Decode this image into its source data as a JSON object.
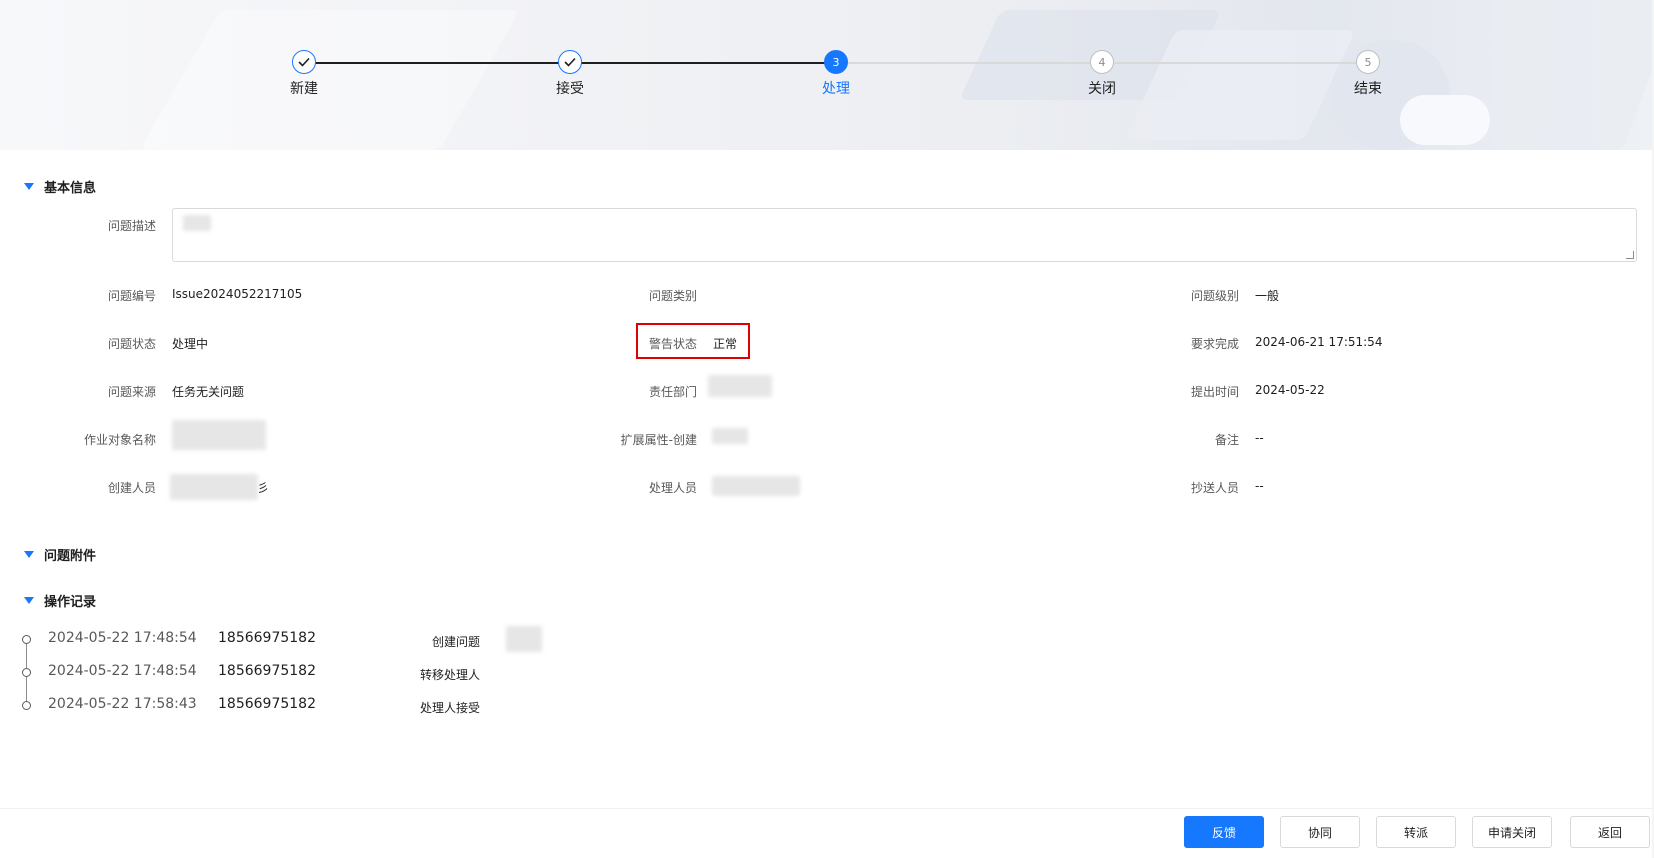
{
  "steps": [
    {
      "label": "新建",
      "status": "finished",
      "icon": "check-icon"
    },
    {
      "label": "接受",
      "status": "finished",
      "icon": "check-icon"
    },
    {
      "label": "处理",
      "status": "active",
      "number": "3"
    },
    {
      "label": "关闭",
      "status": "wait",
      "number": "4"
    },
    {
      "label": "结束",
      "status": "wait",
      "number": "5"
    }
  ],
  "basic_info": {
    "title": "基本信息",
    "description_label": "问题描述",
    "fields": {
      "issue_no_label": "问题编号",
      "issue_no": "Issue2024052217105",
      "category_label": "问题类别",
      "category": "",
      "level_label": "问题级别",
      "level": "一般",
      "status_label": "问题状态",
      "status": "处理中",
      "alert_label": "警告状态",
      "alert": "正常",
      "due_label": "要求完成",
      "due": "2024-06-21 17:51:54",
      "source_label": "问题来源",
      "source": "任务无关问题",
      "dept_label": "责任部门",
      "submit_label": "提出时间",
      "submit": "2024-05-22",
      "object_label": "作业对象名称",
      "ext_label": "扩展属性-创建",
      "remark_label": "备注",
      "remark": "--",
      "creator_label": "创建人员",
      "creator_suffix": "彡",
      "handler_label": "处理人员",
      "cc_label": "抄送人员",
      "cc": "--"
    }
  },
  "attachments": {
    "title": "问题附件"
  },
  "records": {
    "title": "操作记录",
    "items": [
      {
        "time": "2024-05-22 17:48:54",
        "user": "18566975182",
        "action": "创建问题"
      },
      {
        "time": "2024-05-22 17:48:54",
        "user": "18566975182",
        "action": "转移处理人"
      },
      {
        "time": "2024-05-22 17:58:43",
        "user": "18566975182",
        "action": "处理人接受"
      }
    ]
  },
  "footer": {
    "feedback": "反馈",
    "collaborate": "协同",
    "transfer": "转派",
    "apply_close": "申请关闭",
    "back": "返回"
  },
  "colors": {
    "primary": "#1677ff",
    "highlight": "#e00000"
  }
}
